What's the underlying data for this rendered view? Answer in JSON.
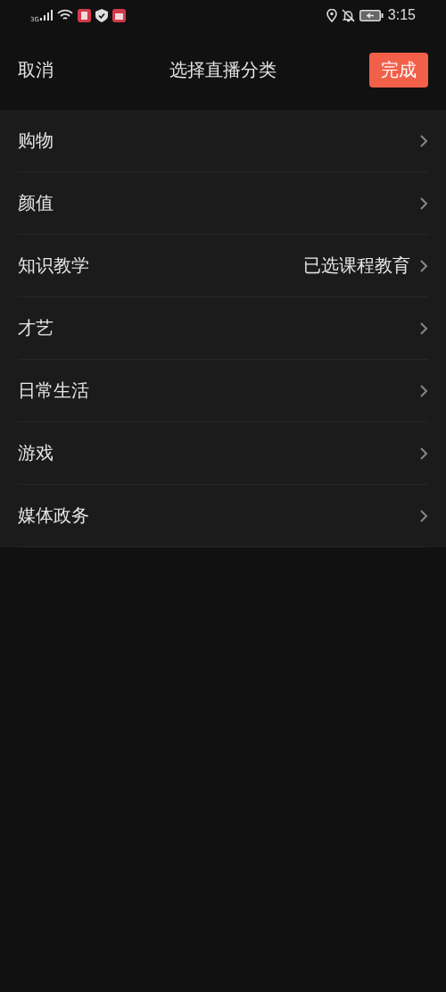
{
  "status_bar": {
    "network": "3G",
    "time": "3:15"
  },
  "header": {
    "cancel": "取消",
    "title": "选择直播分类",
    "done": "完成"
  },
  "categories": [
    {
      "label": "购物"
    },
    {
      "label": "颜值"
    },
    {
      "label": "知识教学",
      "value": "已选课程教育"
    },
    {
      "label": "才艺"
    },
    {
      "label": "日常生活"
    },
    {
      "label": "游戏"
    },
    {
      "label": "媒体政务"
    }
  ]
}
